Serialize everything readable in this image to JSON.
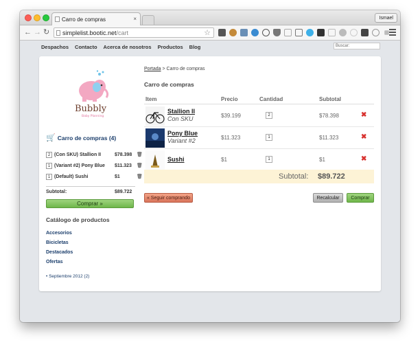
{
  "browser": {
    "tab_title": "Carro de compras",
    "tab_close": "×",
    "user_label": "Ismael",
    "url_host": "simplelist.bootic.net",
    "url_path": "/cart"
  },
  "site": {
    "nav": [
      "Despachos",
      "Contacto",
      "Acerca de nosotros",
      "Productos",
      "Blog"
    ],
    "search_placeholder": "Buscar:"
  },
  "sidebar": {
    "logo_text": "Bubbly",
    "logo_subtext": "Baby Planning",
    "cart_title": "Carro de compras (4)",
    "items": [
      {
        "qty": "2",
        "label": "(Con SKU) Stallion II",
        "price": "$78.398"
      },
      {
        "qty": "1",
        "label": "(Variant #2) Pony Blue",
        "price": "$11.323"
      },
      {
        "qty": "1",
        "label": "(Default) Sushi",
        "price": "$1"
      }
    ],
    "subtotal_label": "Subtotal:",
    "subtotal_value": "$89.722",
    "checkout_label": "Comprar »",
    "catalog_title": "Catálogo de productos",
    "categories": [
      "Accesorios",
      "Bicicletas",
      "Destacados",
      "Ofertas"
    ],
    "archive_link": "Septiembre 2012 (2)"
  },
  "main": {
    "breadcrumb_link": "Portada",
    "breadcrumb_sep": " > ",
    "breadcrumb_current": "Carro de compras",
    "title": "Carro de compras",
    "columns": {
      "item": "Item",
      "price": "Precio",
      "qty": "Cantidad",
      "subtotal": "Subtotal"
    },
    "rows": [
      {
        "name": "Stallion II",
        "variant": "Con SKU",
        "price": "$39.199",
        "qty": "2",
        "subtotal": "$78.398"
      },
      {
        "name": "Pony Blue",
        "variant": "Variant #2",
        "price": "$11.323",
        "qty": "1",
        "subtotal": "$11.323"
      },
      {
        "name": "Sushi",
        "variant": "",
        "price": "$1",
        "qty": "1",
        "subtotal": "$1"
      }
    ],
    "remove_symbol": "✖",
    "subtotal_label": "Subtotal:",
    "subtotal_value": "$89.722",
    "continue_label": "« Seguir comprando",
    "recalc_label": "Recalcular",
    "buy_label": "Comprar"
  },
  "colors": {
    "accent_green": "#6fb64a",
    "remove_red": "#d8322f",
    "link_blue": "#1a3d6b",
    "subtotal_bg": "#fdf3d6"
  }
}
